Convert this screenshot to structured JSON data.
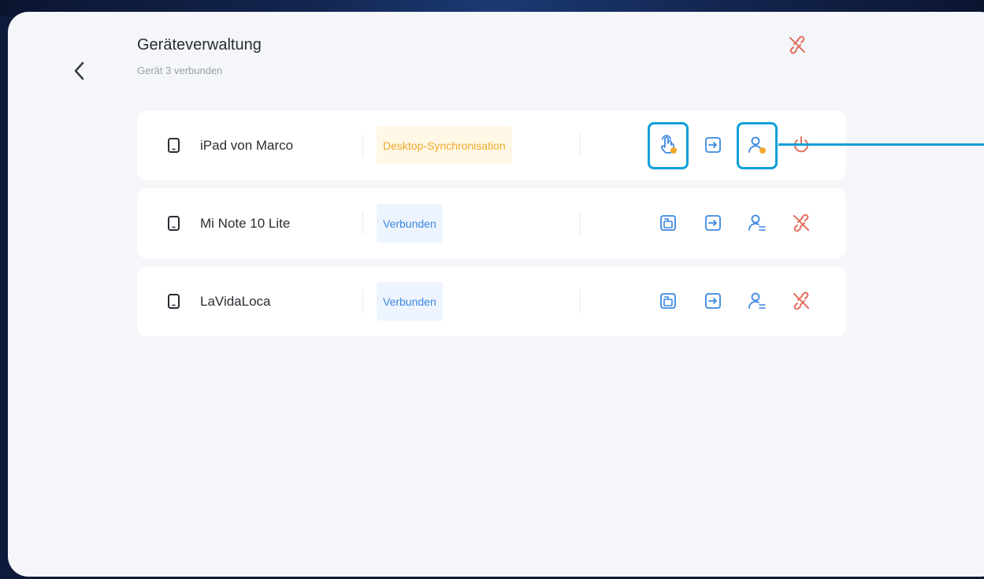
{
  "header": {
    "title": "Geräteverwaltung",
    "subtitle": "Gerät 3 verbunden"
  },
  "colors": {
    "accent_blue": "#3b87e0",
    "sync_orange": "#f2a82c",
    "disconnect_red": "#e2705e",
    "highlight": "#0ea0d8"
  },
  "devices": [
    {
      "name": "iPad von Marco",
      "status": "Desktop-Synchronisation",
      "status_type": "sync"
    },
    {
      "name": "Mi Note 10 Lite",
      "status": "Verbunden",
      "status_type": "connected"
    },
    {
      "name": "LaVidaLoca",
      "status": "Verbunden",
      "status_type": "connected"
    }
  ]
}
